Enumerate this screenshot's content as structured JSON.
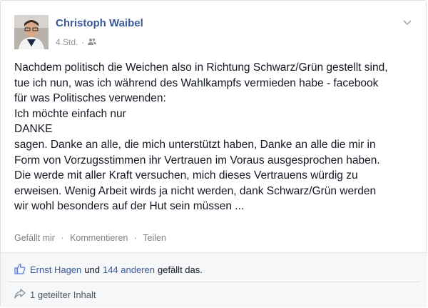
{
  "post": {
    "author": "Christoph Waibel",
    "time": "4 Std.",
    "separator": "·",
    "audience_icon": "friends-icon",
    "menu_icon": "chevron-down-icon",
    "lines": [
      "Nachdem politisch die Weichen also in Richtung Schwarz/Grün gestellt sind,",
      "tue ich nun, was ich während des Wahlkampfs vermieden habe - facebook",
      "für was Politisches verwenden:",
      "Ich möchte einfach nur",
      "DANKE",
      "sagen. Danke an alle, die mich unterstützt haben, Danke an alle die mir in",
      "Form von Vorzugsstimmen ihr Vertrauen im Voraus ausgesprochen haben.",
      "Die werde mit aller Kraft versuchen, mich dieses Vertrauens würdig zu",
      "erweisen. Wenig Arbeit wirds ja nicht werden, dank Schwarz/Grün werden",
      "wir wohl besonders auf der Hut sein müssen ..."
    ]
  },
  "actions": {
    "like": "Gefällt mir",
    "comment": "Kommentieren",
    "share": "Teilen",
    "separator": "·"
  },
  "likes": {
    "icon": "thumbs-up-icon",
    "name": "Ernst Hagen",
    "conjunction": "und",
    "others": "144 anderen",
    "suffix": "gefällt das."
  },
  "shares": {
    "icon": "share-arrow-icon",
    "text": "1 geteilter Inhalt"
  },
  "colors": {
    "link": "#3b5998",
    "text": "#141823",
    "muted": "#90949c",
    "footer_bg": "#f6f7f9"
  }
}
